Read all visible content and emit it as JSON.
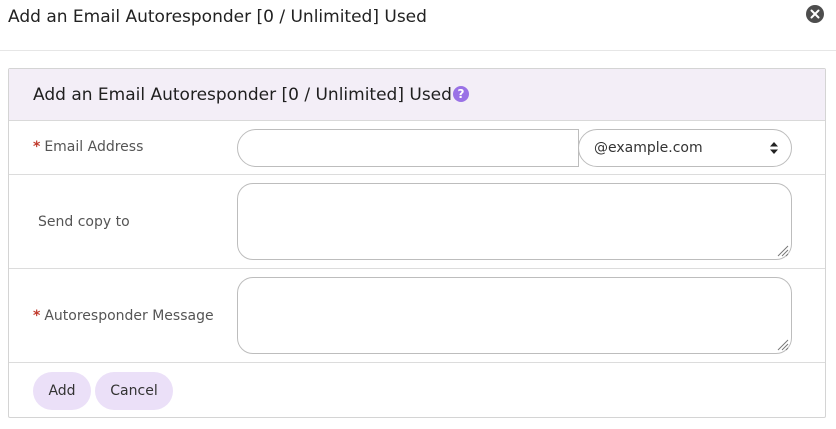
{
  "modal": {
    "title": "Add an Email Autoresponder [0 / Unlimited] Used"
  },
  "panel": {
    "title": "Add an Email Autoresponder [0 / Unlimited] Used",
    "help_icon": "?"
  },
  "form": {
    "email": {
      "required_mark": "*",
      "label": "Email Address",
      "value": "",
      "placeholder": "",
      "domain_selected": "@example.com"
    },
    "send_copy": {
      "label": "Send copy to",
      "value": ""
    },
    "message": {
      "required_mark": "*",
      "label": "Autoresponder Message",
      "value": ""
    }
  },
  "buttons": {
    "add_label": "Add",
    "cancel_label": "Cancel"
  },
  "icons": {
    "close": "close-icon",
    "help": "help-icon",
    "select_arrows": "sort-arrows-icon",
    "resize": "resize-grip-icon"
  },
  "colors": {
    "panel_header_bg": "#f3eef7",
    "accent_button_bg": "#ebe0f8",
    "help_icon": "#9a72e6",
    "required": "#c0392b"
  }
}
